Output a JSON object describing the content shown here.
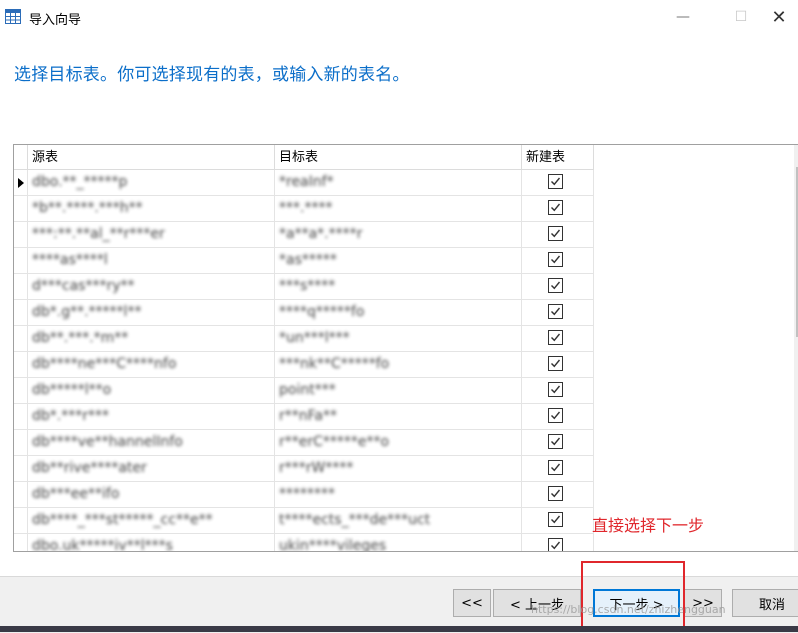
{
  "window": {
    "title": "导入向导",
    "minimize_glyph": "—",
    "maximize_glyph": "☐",
    "close_glyph": "✕"
  },
  "heading": "选择目标表。你可选择现有的表，或输入新的表名。",
  "table": {
    "columns": {
      "source": "源表",
      "target": "目标表",
      "new_table": "新建表"
    },
    "rows": [
      {
        "source": "dbo.**_*****p",
        "target": "*reaInf*",
        "new_table": true
      },
      {
        "source": "*b**.****.***h**",
        "target": "***.****",
        "new_table": true
      },
      {
        "source": "***:**.**al_**r***er",
        "target": "*a**a*.****r",
        "new_table": true
      },
      {
        "source": "****as****l",
        "target": "*as*****",
        "new_table": true
      },
      {
        "source": "d***cas***ry**",
        "target": "***s****",
        "new_table": true
      },
      {
        "source": "db*.g**.*****l**",
        "target": "****q*****fo",
        "new_table": true
      },
      {
        "source": "db**.***.*m**",
        "target": "*un***l***",
        "new_table": true
      },
      {
        "source": "db****ne***C****nfo",
        "target": "***nk**C*****fo",
        "new_table": true
      },
      {
        "source": "db*****l**o",
        "target": "point***",
        "new_table": true
      },
      {
        "source": "db*.***r***",
        "target": "r**nFa**",
        "new_table": true
      },
      {
        "source": "db****ve**hannelInfo",
        "target": "r**erC*****e**o",
        "new_table": true
      },
      {
        "source": "db**rive****ater",
        "target": "r***rW****",
        "new_table": true
      },
      {
        "source": "db***ee**ifo",
        "target": "********",
        "new_table": true
      },
      {
        "source": "db****_***st*****_cc**e**",
        "target": "t****ects_***de***uct",
        "new_table": true
      },
      {
        "source": "dbo.uk*****iv**l***s",
        "target": "ukin****vileges",
        "new_table": true
      }
    ]
  },
  "annotation": "直接选择下一步",
  "buttons": {
    "first": "<<",
    "prev": "< 上一步",
    "next": "下一步 >",
    "last": ">>",
    "cancel": "取消"
  },
  "watermark": "https://blog.csdn.net/zhizhengguan",
  "colors": {
    "heading": "#0b6ec9",
    "annotation": "#e0272c",
    "default_button_border": "#0078d7"
  }
}
